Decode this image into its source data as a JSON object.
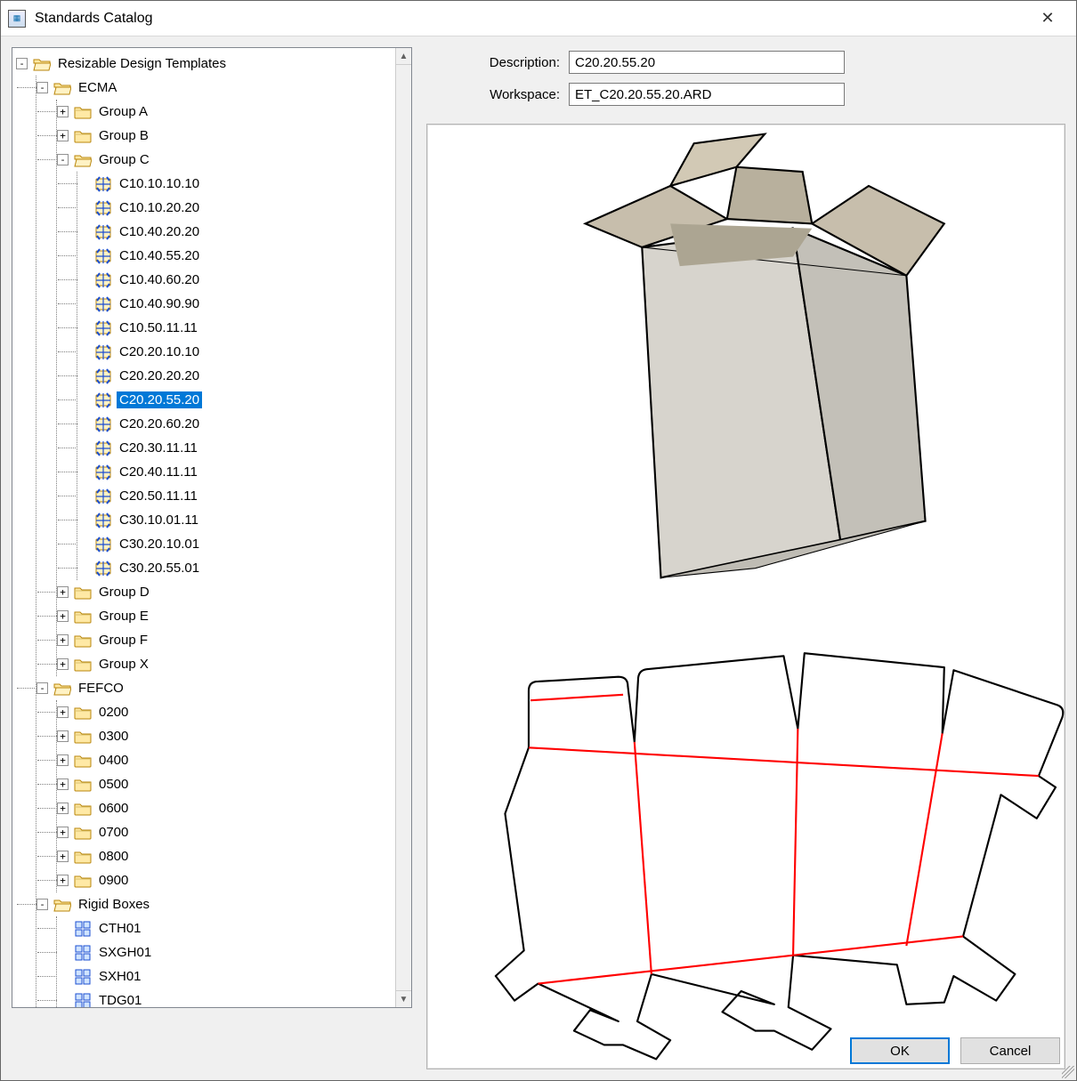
{
  "window": {
    "title": "Standards Catalog"
  },
  "form": {
    "description_label": "Description:",
    "workspace_label": "Workspace:",
    "description_value": "C20.20.55.20",
    "workspace_value": "ET_C20.20.55.20.ARD"
  },
  "buttons": {
    "ok": "OK",
    "cancel": "Cancel"
  },
  "tree": {
    "root": "Resizable Design Templates",
    "ecma": "ECMA",
    "groupA": "Group A",
    "groupB": "Group B",
    "groupC": "Group C",
    "groupD": "Group D",
    "groupE": "Group E",
    "groupF": "Group F",
    "groupX": "Group X",
    "fefco": "FEFCO",
    "f0200": "0200",
    "f0300": "0300",
    "f0400": "0400",
    "f0500": "0500",
    "f0600": "0600",
    "f0700": "0700",
    "f0800": "0800",
    "f0900": "0900",
    "rigid": "Rigid Boxes",
    "cth01": "CTH01",
    "sxgh01": "SXGH01",
    "sxh01": "SXH01",
    "tdg01": "TDG01",
    "c_items": [
      "C10.10.10.10",
      "C10.10.20.20",
      "C10.40.20.20",
      "C10.40.55.20",
      "C10.40.60.20",
      "C10.40.90.90",
      "C10.50.11.11",
      "C20.20.10.10",
      "C20.20.20.20",
      "C20.20.55.20",
      "C20.20.60.20",
      "C20.30.11.11",
      "C20.40.11.11",
      "C20.50.11.11",
      "C30.10.01.11",
      "C30.20.10.01",
      "C30.20.55.01"
    ],
    "selected_index": 9
  }
}
